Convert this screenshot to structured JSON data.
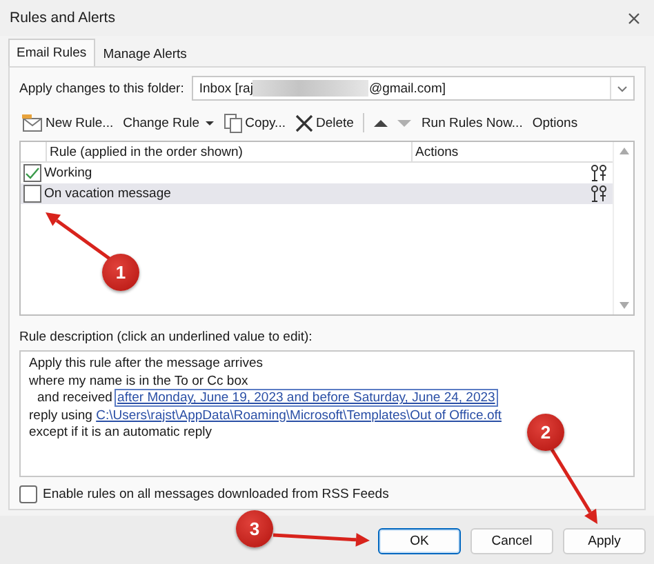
{
  "window": {
    "title": "Rules and Alerts"
  },
  "tabs": [
    {
      "label": "Email Rules",
      "selected": true
    },
    {
      "label": "Manage Alerts",
      "selected": false
    }
  ],
  "folder": {
    "label": "Apply changes to this folder:",
    "value_start": "Inbox [raj",
    "value_end": "@gmail.com]"
  },
  "toolbar": [
    {
      "kind": "new",
      "label": "New Rule...",
      "disabled": false
    },
    {
      "kind": "change",
      "label": "Change Rule",
      "disabled": false
    },
    {
      "kind": "copy",
      "label": "Copy...",
      "disabled": false
    },
    {
      "kind": "delete",
      "label": "Delete",
      "disabled": false
    },
    {
      "kind": "up",
      "disabled": false
    },
    {
      "kind": "down",
      "disabled": true
    },
    {
      "kind": "run",
      "label": "Run Rules Now...",
      "disabled": false
    },
    {
      "kind": "options",
      "label": "Options",
      "disabled": false
    }
  ],
  "rules_table": {
    "columns": [
      "Rule (applied in the order shown)",
      "Actions"
    ],
    "rows": [
      {
        "name": "Working",
        "checked": true,
        "selected": false
      },
      {
        "name": "On vacation message",
        "checked": false,
        "selected": true
      }
    ]
  },
  "description": {
    "label": "Rule description (click an underlined value to edit):",
    "lines": [
      {
        "text": "Apply this rule after the message arrives",
        "indent": false
      },
      {
        "text": "where my name is in the To or Cc box",
        "indent": false
      },
      {
        "text": "and received",
        "link": "after Monday, June 19, 2023 and before Saturday, June 24, 2023",
        "indent": true,
        "boxed": true
      },
      {
        "text": "reply using",
        "link": "C:\\Users\\rajst\\AppData\\Roaming\\Microsoft\\Templates\\Out of Office.oft",
        "indent": false,
        "boxed": false
      },
      {
        "text": "except if it is an automatic reply",
        "indent": false
      }
    ]
  },
  "rss_option": {
    "label": "Enable rules on all messages downloaded from RSS Feeds",
    "checked": false
  },
  "buttons": [
    {
      "label": "OK",
      "default": true
    },
    {
      "label": "Cancel",
      "default": false
    },
    {
      "label": "Apply",
      "default": false
    }
  ],
  "annotations": [
    {
      "label": "1"
    },
    {
      "label": "2"
    },
    {
      "label": "3"
    }
  ]
}
